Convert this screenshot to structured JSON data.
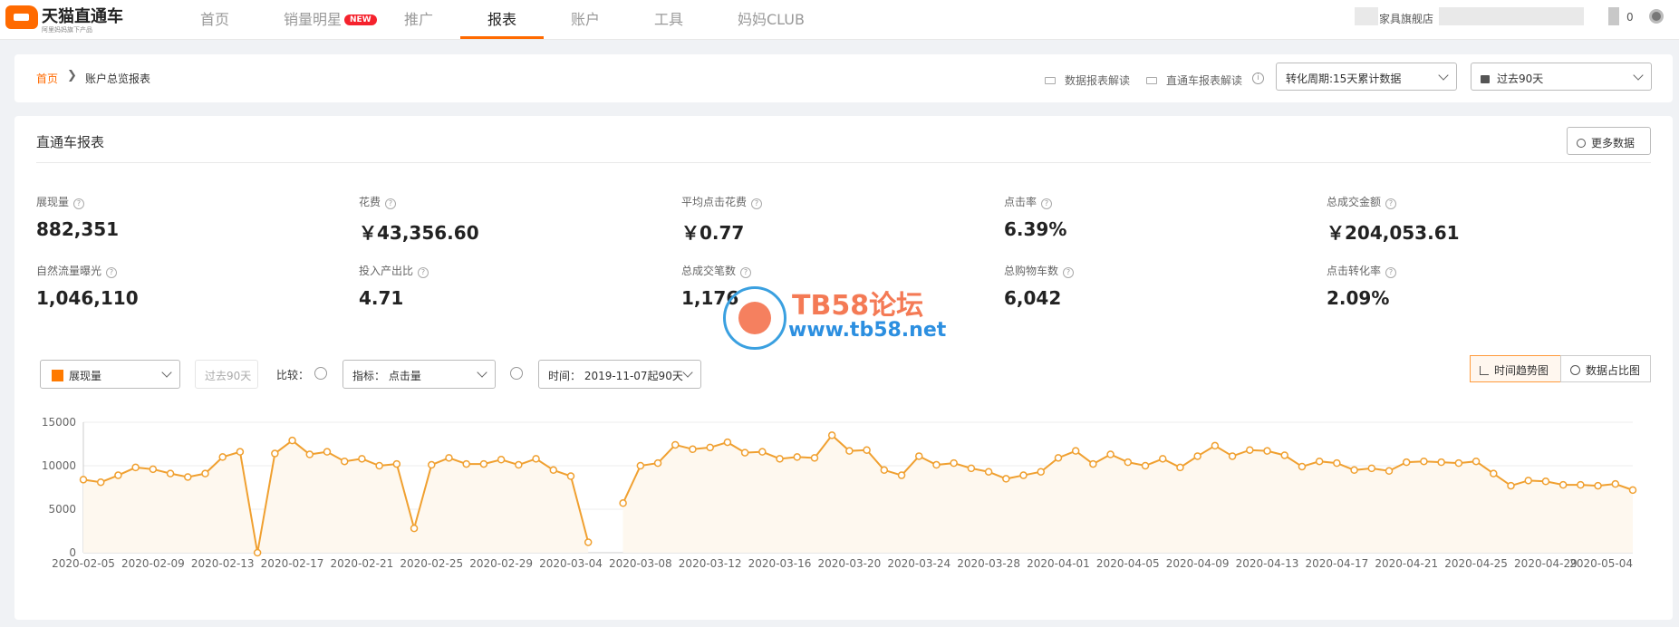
{
  "brand": {
    "name": "天猫直通车",
    "tagline": "阿里妈妈旗下产品"
  },
  "nav": [
    {
      "label": "首页",
      "badge": ""
    },
    {
      "label": "销量明星",
      "badge": "NEW"
    },
    {
      "label": "推广",
      "badge": ""
    },
    {
      "label": "报表",
      "badge": ""
    },
    {
      "label": "账户",
      "badge": ""
    },
    {
      "label": "工具",
      "badge": ""
    },
    {
      "label": "妈妈CLUB",
      "badge": ""
    }
  ],
  "active_nav": "报表",
  "account": {
    "shop": "家具旗舰店",
    "count": "0"
  },
  "breadcrumb": {
    "home": "首页",
    "current": "账户总览报表"
  },
  "toolbar": {
    "data_report_guide": "数据报表解读",
    "ztc_report_guide": "直通车报表解读",
    "conversion_period": "转化周期:15天累计数据",
    "date_range": "过去90天"
  },
  "section": {
    "title": "直通车报表",
    "more_button": "更多数据"
  },
  "metrics": [
    {
      "label": "展现量",
      "value": "882,351"
    },
    {
      "label": "花费",
      "value": "￥43,356.60"
    },
    {
      "label": "平均点击花费",
      "value": "￥0.77"
    },
    {
      "label": "点击率",
      "value": "6.39%"
    },
    {
      "label": "总成交金额",
      "value": "￥204,053.61"
    },
    {
      "label": "自然流量曝光",
      "value": "1,046,110"
    },
    {
      "label": "投入产出比",
      "value": "4.71"
    },
    {
      "label": "总成交笔数",
      "value": "1,176"
    },
    {
      "label": "总购物车数",
      "value": "6,042"
    },
    {
      "label": "点击转化率",
      "value": "2.09%"
    }
  ],
  "watermark": {
    "title": "TB58论坛",
    "url": "www.tb58.net"
  },
  "chart_controls": {
    "metric": "展现量",
    "compare_period": "过去90天",
    "compare_label": "比较：",
    "indicator": "指标： 点击量",
    "time": "时间： 2019-11-07起90天",
    "trend_button": "时间趋势图",
    "share_button": "数据占比图"
  },
  "colors": {
    "accent": "#ff6a00",
    "line": "#f0a030",
    "area": "#fef8ef",
    "new_badge": "#f5222d",
    "watermark_orange": "#f47a55",
    "watermark_blue": "#2c8fe0"
  },
  "chart_data": {
    "type": "line",
    "title": "",
    "xlabel": "",
    "ylabel": "",
    "ylim": [
      0,
      15000
    ],
    "yticks": [
      0,
      5000,
      10000,
      15000
    ],
    "xticks": [
      "2020-02-05",
      "2020-02-09",
      "2020-02-13",
      "2020-02-17",
      "2020-02-21",
      "2020-02-25",
      "2020-02-29",
      "2020-03-04",
      "2020-03-08",
      "2020-03-12",
      "2020-03-16",
      "2020-03-20",
      "2020-03-24",
      "2020-03-28",
      "2020-04-01",
      "2020-04-05",
      "2020-04-09",
      "2020-04-13",
      "2020-04-17",
      "2020-04-21",
      "2020-04-25",
      "2020-04-29",
      "2020-05-04"
    ],
    "x_start": "2020-02-05",
    "grid": true,
    "series": [
      {
        "values": [
          8400,
          8100,
          8900,
          9800,
          9600,
          9100,
          8700,
          9100,
          11000,
          11600,
          0,
          11400,
          12900,
          11300,
          11600,
          10500,
          10800,
          10000,
          10200,
          2800,
          10100,
          10900,
          10200,
          10200,
          10700,
          10100,
          10800,
          9500,
          8800,
          1200,
          null,
          5700,
          10000,
          10300,
          12400,
          11900,
          12100,
          12700,
          11500,
          11600,
          10800,
          11000,
          10900,
          13500,
          11700,
          11800,
          9500,
          8900,
          11100,
          10100,
          10300,
          9700,
          9300,
          8500,
          8900,
          9300,
          10900,
          11700,
          10200,
          11300,
          10400,
          10000,
          10800,
          9800,
          11100,
          12300,
          11100,
          11800,
          11700,
          11200,
          9900,
          10500,
          10300,
          9500,
          9700,
          9400,
          10400,
          10500,
          10400,
          10300,
          10500,
          9100,
          7700,
          8300,
          8200,
          7800,
          7800,
          7700,
          7900,
          7200
        ]
      }
    ]
  }
}
